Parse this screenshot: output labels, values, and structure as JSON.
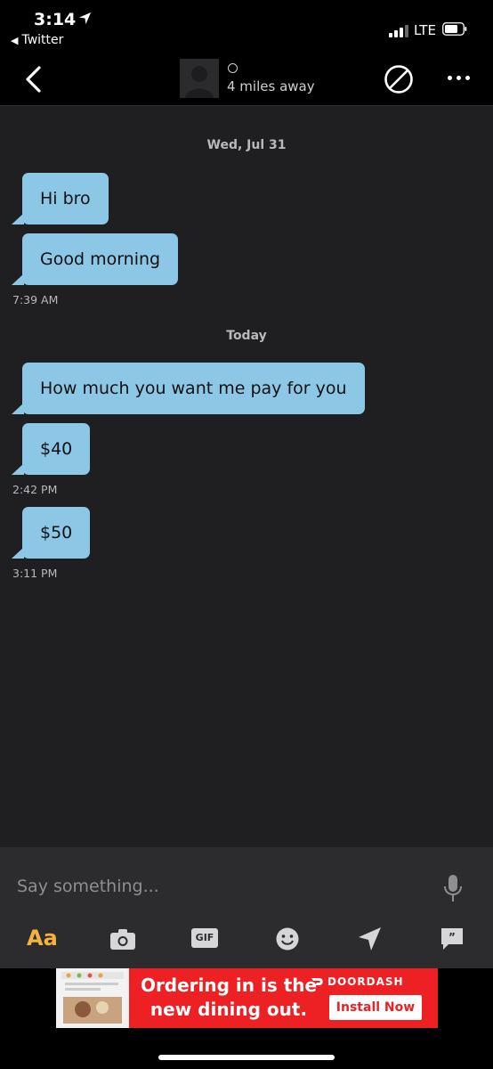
{
  "status_bar": {
    "time": "3:14",
    "back_app": "Twitter",
    "network": "LTE"
  },
  "header": {
    "distance": "4 miles away"
  },
  "messages": [
    {
      "type": "date",
      "text": "Wed, Jul 31"
    },
    {
      "type": "bubble",
      "text": "Hi bro"
    },
    {
      "type": "bubble",
      "text": "Good morning"
    },
    {
      "type": "timestamp",
      "text": "7:39 AM"
    },
    {
      "type": "date",
      "text": "Today"
    },
    {
      "type": "bubble",
      "text": "How much you want me pay for you"
    },
    {
      "type": "bubble",
      "text": "$40"
    },
    {
      "type": "timestamp",
      "text": "2:42 PM"
    },
    {
      "type": "bubble",
      "text": "$50"
    },
    {
      "type": "timestamp",
      "text": "3:11 PM"
    }
  ],
  "composer": {
    "placeholder": "Say something...",
    "toolbar": {
      "text_format": "Aa",
      "gif": "GIF"
    }
  },
  "ad": {
    "headline_line1": "Ordering in is the",
    "headline_line2": "new dining out.",
    "brand": "DOORDASH",
    "cta": "Install Now"
  },
  "colors": {
    "background": "#1f1f21",
    "bubble": "#8dc7e6",
    "accent": "#f5b33d",
    "ad_red": "#ed2024"
  }
}
